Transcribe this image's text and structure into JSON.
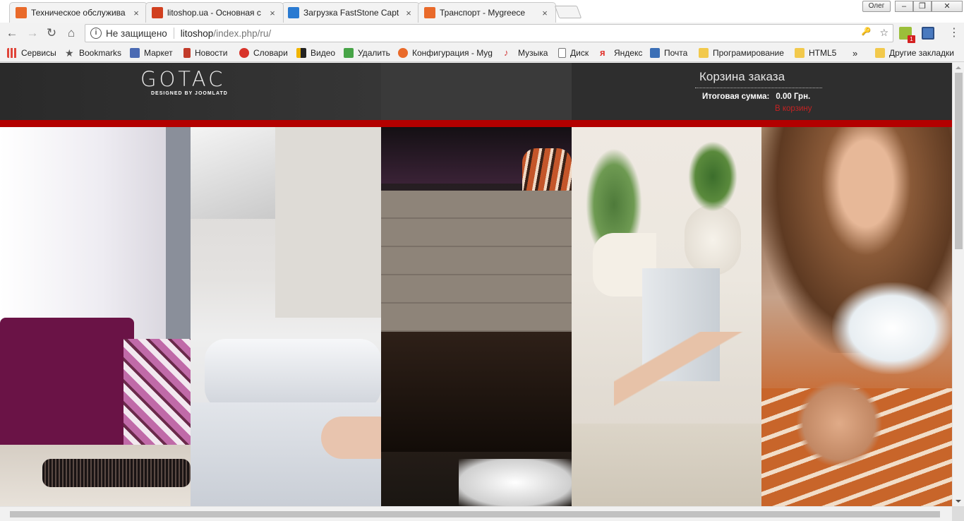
{
  "browser": {
    "tabs": [
      {
        "title": "Техническое обслужива",
        "active": false,
        "favicon": "joomla-icon",
        "color": "#e96a2a"
      },
      {
        "title": "litoshop.ua - Основная с",
        "active": true,
        "favicon": "joomla-icon",
        "color": "#d14020"
      },
      {
        "title": "Загрузка FastStone Capt",
        "active": false,
        "favicon": "download-icon",
        "color": "#2a7ad1"
      },
      {
        "title": "Транспорт - Mygreece",
        "active": false,
        "favicon": "joomla-icon",
        "color": "#e96a2a"
      }
    ],
    "tab_close_glyph": "×",
    "user_name": "Олег",
    "window_controls": {
      "minimize": "–",
      "maximize": "❐",
      "close": "✕"
    },
    "nav": {
      "back": "←",
      "forward": "→",
      "reload": "↻",
      "home": "⌂"
    },
    "omnibox": {
      "security_label": "Не защищено",
      "info_glyph": "i",
      "url_host": "litoshop",
      "url_path": "/index.php/ru/",
      "key_glyph": "🔑",
      "star_glyph": "☆"
    },
    "extensions": {
      "badge": "1"
    },
    "menu_glyph": "⋮"
  },
  "bookmarks": {
    "items": [
      {
        "label": "Сервисы",
        "icon": "apps-icon",
        "color": "#e0453a"
      },
      {
        "label": "Bookmarks",
        "icon": "star-icon",
        "color": "#555555"
      },
      {
        "label": "Маркет",
        "icon": "market-icon",
        "color": "#4a6ab3"
      },
      {
        "label": "Новости",
        "icon": "news-icon",
        "color": "#c23b2a"
      },
      {
        "label": "Словари",
        "icon": "dictionary-icon",
        "color": "#d8332a"
      },
      {
        "label": "Видео",
        "icon": "video-icon",
        "color": "#f0b400"
      },
      {
        "label": "Удалить",
        "icon": "mail-icon",
        "color": "#47a447"
      },
      {
        "label": "Конфигурация - Myg",
        "icon": "joomla-icon",
        "color": "#e96a2a"
      },
      {
        "label": "Музыка",
        "icon": "music-icon",
        "color": "#d23a3a"
      },
      {
        "label": "Диск",
        "icon": "page-icon",
        "color": "#777777"
      },
      {
        "label": "Яндекс",
        "icon": "yandex-icon",
        "color": "#e0312a"
      },
      {
        "label": "Почта",
        "icon": "envelope-icon",
        "color": "#3b6fb6"
      },
      {
        "label": "Програмирование",
        "icon": "folder-icon",
        "color": "#f2c94c"
      },
      {
        "label": "HTML5",
        "icon": "folder-icon",
        "color": "#f2c94c"
      }
    ],
    "overflow": "»",
    "other": {
      "label": "Другие закладки",
      "icon": "folder-icon"
    }
  },
  "site": {
    "logo": {
      "title": "GOTAC",
      "subtitle": "DESIGNED BY JOOMLATD"
    },
    "cart": {
      "title": "Корзина заказа",
      "total_label": "Итоговая сумма:",
      "total_value": "0.00 Грн.",
      "link": "В корзину"
    },
    "accent_color": "#b30000",
    "panels": [
      "bedroom-curtains-photo",
      "white-bed-photo",
      "dark-bed-photo",
      "interior-chair-photo",
      "model-photo"
    ]
  }
}
